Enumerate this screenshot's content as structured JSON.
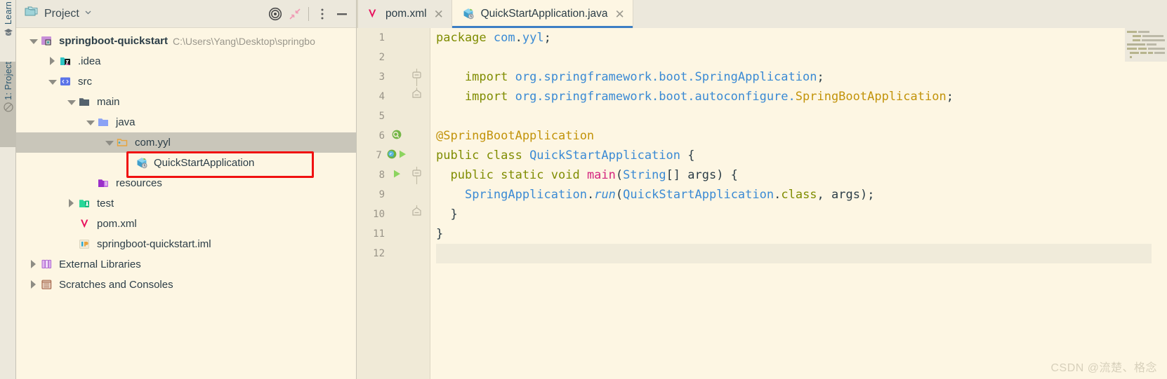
{
  "toolstrip": {
    "learn_label": "Learn",
    "learn_icon": "graduation-cap-icon",
    "project_label": "1: Project",
    "structure_icon": "structure-icon"
  },
  "project_panel": {
    "title": "Project",
    "title_icon": "project-folder-icon",
    "dropdown_icon": "chevron-down-icon",
    "toolbar": [
      {
        "name": "select-opened-file-icon",
        "glyph": "target-icon"
      },
      {
        "name": "collapse-all-icon",
        "glyph": "collapse-arrows-icon"
      },
      {
        "name": "options-menu-icon",
        "glyph": "vertical-dots-icon"
      },
      {
        "name": "hide-panel-icon",
        "glyph": "minus-icon"
      }
    ],
    "tree": [
      {
        "label": "springboot-quickstart",
        "path": "C:\\Users\\Yang\\Desktop\\springbo",
        "indent": 0,
        "arrow": "down",
        "icon": "module-folder-icon",
        "bold": true,
        "selected": false
      },
      {
        "label": ".idea",
        "path": "",
        "indent": 1,
        "arrow": "right",
        "icon": "idea-folder-icon",
        "bold": false,
        "selected": false
      },
      {
        "label": "src",
        "path": "",
        "indent": 1,
        "arrow": "down",
        "icon": "source-root-icon",
        "bold": false,
        "selected": false
      },
      {
        "label": "main",
        "path": "",
        "indent": 2,
        "arrow": "down",
        "icon": "folder-dark-icon",
        "bold": false,
        "selected": false
      },
      {
        "label": "java",
        "path": "",
        "indent": 3,
        "arrow": "down",
        "icon": "java-source-folder-icon",
        "bold": false,
        "selected": false
      },
      {
        "label": "com.yyl",
        "path": "",
        "indent": 4,
        "arrow": "down",
        "icon": "package-icon",
        "bold": false,
        "selected": true
      },
      {
        "label": "QuickStartApplication",
        "path": "",
        "indent": 5,
        "arrow": "none",
        "icon": "spring-boot-class-icon",
        "bold": false,
        "selected": false
      },
      {
        "label": "resources",
        "path": "",
        "indent": 3,
        "arrow": "none",
        "icon": "resources-folder-icon",
        "bold": false,
        "selected": false
      },
      {
        "label": "test",
        "path": "",
        "indent": 2,
        "arrow": "right",
        "icon": "test-folder-icon",
        "bold": false,
        "selected": false
      },
      {
        "label": "pom.xml",
        "path": "",
        "indent": 2,
        "arrow": "none",
        "icon": "maven-icon",
        "bold": false,
        "selected": false
      },
      {
        "label": "springboot-quickstart.iml",
        "path": "",
        "indent": 2,
        "arrow": "none",
        "icon": "iml-file-icon",
        "bold": false,
        "selected": false
      },
      {
        "label": "External Libraries",
        "path": "",
        "indent": 0,
        "arrow": "right",
        "icon": "libraries-icon",
        "bold": false,
        "selected": false
      },
      {
        "label": "Scratches and Consoles",
        "path": "",
        "indent": 0,
        "arrow": "right",
        "icon": "scratches-icon",
        "bold": false,
        "selected": false
      }
    ],
    "highlight": {
      "target_row_label": "QuickStartApplication",
      "border_color": "#f01010"
    }
  },
  "editor": {
    "tabs": [
      {
        "label": "pom.xml",
        "icon": "maven-icon",
        "close_icon": "close-icon",
        "active": false
      },
      {
        "label": "QuickStartApplication.java",
        "icon": "spring-boot-class-icon",
        "close_icon": "close-icon",
        "active": true
      }
    ],
    "line_numbers": [
      "1",
      "2",
      "3",
      "4",
      "5",
      "6",
      "7",
      "8",
      "9",
      "10",
      "11",
      "12"
    ],
    "gutter_marks": [
      {
        "line": "6",
        "icon": "spring-leaf-icon"
      },
      {
        "line": "7",
        "icon": "spring-bean-icon"
      },
      {
        "line": "7",
        "icon": "run-arrow-icon"
      },
      {
        "line": "8",
        "icon": "run-arrow-icon"
      }
    ],
    "fold_marks": [
      {
        "line": "3",
        "icon": "fold-start-icon"
      },
      {
        "line": "4",
        "icon": "fold-end-icon"
      },
      {
        "line": "8",
        "icon": "fold-start-icon"
      },
      {
        "line": "10",
        "icon": "fold-end-icon"
      }
    ],
    "code_lines": [
      {
        "n": "1",
        "tokens": [
          {
            "t": "package ",
            "c": "kw"
          },
          {
            "t": "com",
            "c": "typ"
          },
          {
            "t": ".",
            "c": "pln"
          },
          {
            "t": "yyl",
            "c": "typ"
          },
          {
            "t": ";",
            "c": "pln"
          }
        ]
      },
      {
        "n": "2",
        "tokens": []
      },
      {
        "n": "3",
        "tokens": [
          {
            "t": "    import ",
            "c": "kw"
          },
          {
            "t": "org.springframework.boot.",
            "c": "typ"
          },
          {
            "t": "SpringApplication",
            "c": "typ"
          },
          {
            "t": ";",
            "c": "pln"
          }
        ]
      },
      {
        "n": "4",
        "tokens": [
          {
            "t": "    import ",
            "c": "kw"
          },
          {
            "t": "org.springframework.boot.autoconfigure.",
            "c": "typ"
          },
          {
            "t": "SpringBootApplication",
            "c": "ann"
          },
          {
            "t": ";",
            "c": "pln"
          }
        ]
      },
      {
        "n": "5",
        "tokens": []
      },
      {
        "n": "6",
        "tokens": [
          {
            "t": "@SpringBootApplication",
            "c": "ann"
          }
        ]
      },
      {
        "n": "7",
        "tokens": [
          {
            "t": "public class ",
            "c": "kw"
          },
          {
            "t": "QuickStartApplication",
            "c": "typ"
          },
          {
            "t": " {",
            "c": "pln"
          }
        ]
      },
      {
        "n": "8",
        "tokens": [
          {
            "t": "  public static void ",
            "c": "kw"
          },
          {
            "t": "main",
            "c": "mth"
          },
          {
            "t": "(",
            "c": "pln"
          },
          {
            "t": "String",
            "c": "typ"
          },
          {
            "t": "[] args) {",
            "c": "pln"
          }
        ]
      },
      {
        "n": "9",
        "tokens": [
          {
            "t": "    ",
            "c": "pln"
          },
          {
            "t": "SpringApplication",
            "c": "typ"
          },
          {
            "t": ".",
            "c": "pln"
          },
          {
            "t": "run",
            "c": "run"
          },
          {
            "t": "(",
            "c": "pln"
          },
          {
            "t": "QuickStartApplication",
            "c": "typ"
          },
          {
            "t": ".",
            "c": "pln"
          },
          {
            "t": "class",
            "c": "kw"
          },
          {
            "t": ", args);",
            "c": "pln"
          }
        ]
      },
      {
        "n": "10",
        "tokens": [
          {
            "t": "  }",
            "c": "pln"
          }
        ]
      },
      {
        "n": "11",
        "tokens": [
          {
            "t": "}",
            "c": "pln"
          }
        ]
      },
      {
        "n": "12",
        "tokens": []
      }
    ],
    "current_line": "12",
    "inspection": {
      "status_icon": "green-check-icon",
      "status_color": "#8cc152"
    },
    "minimap_icon": "code-minimap-icon"
  },
  "watermark": {
    "text": "CSDN @流楚、格念"
  },
  "colors": {
    "editor_bg": "#fdf6e3",
    "panel_bg": "#ecE8dc",
    "selection": "#c9c6ba",
    "tab_underline": "#3d7ec4"
  }
}
